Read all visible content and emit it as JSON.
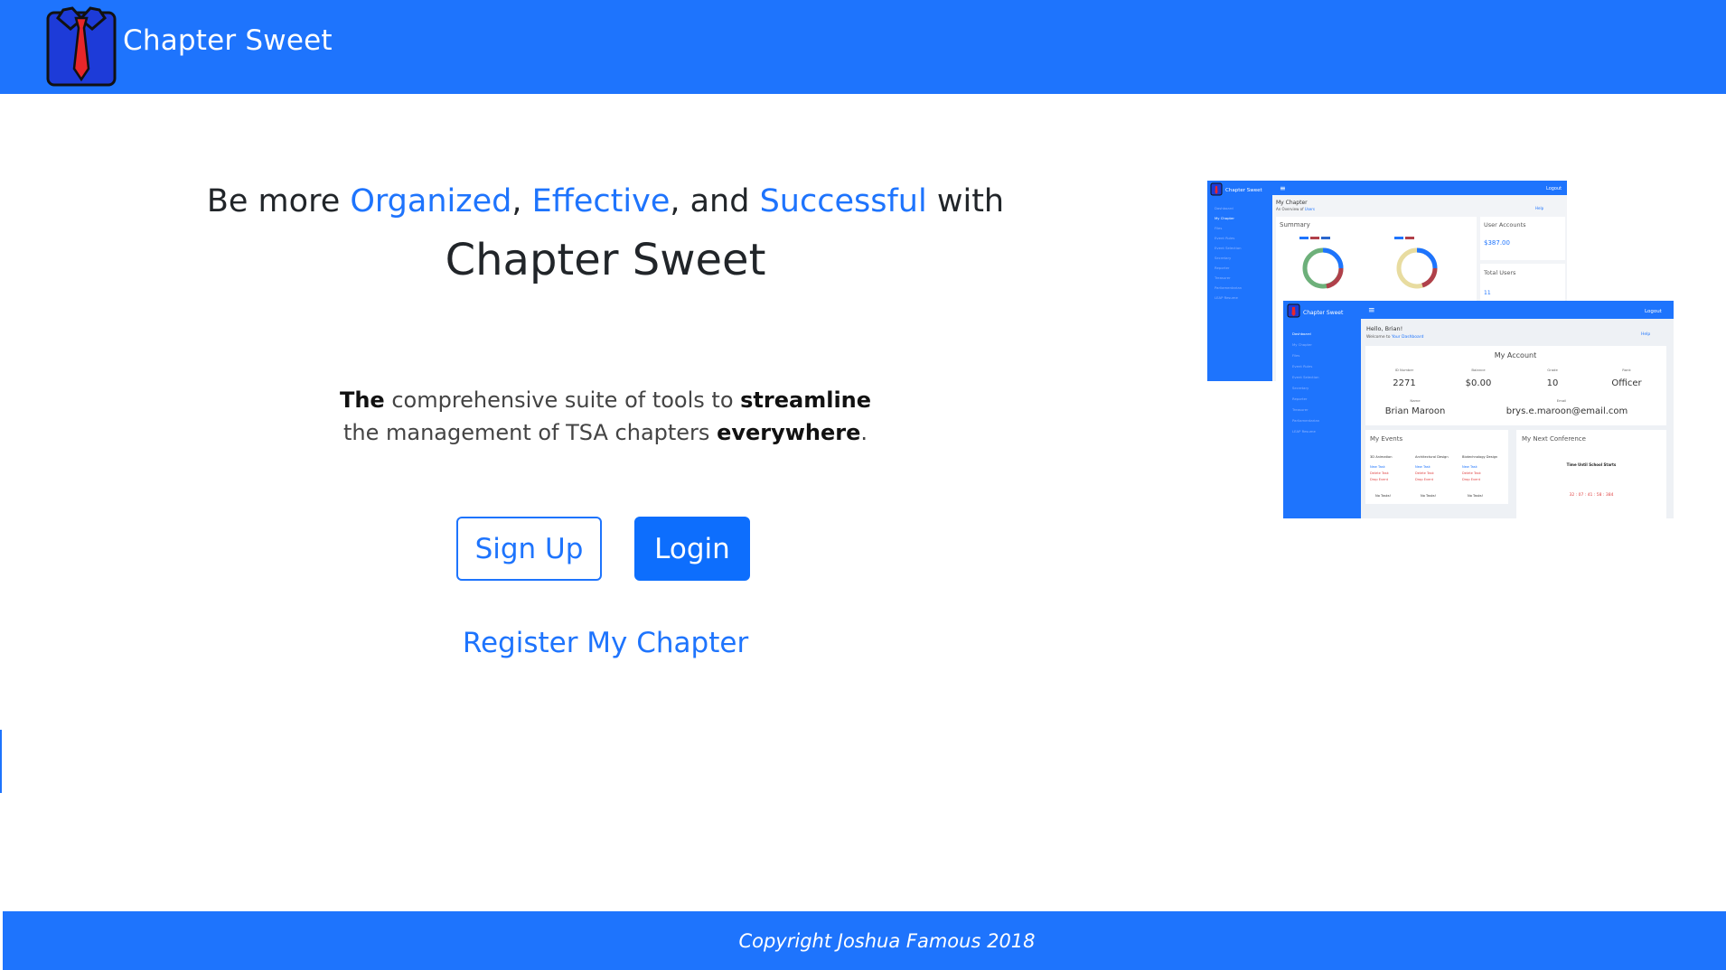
{
  "navbar": {
    "brand": "Chapter Sweet",
    "logo_icon": "tie-shirt-icon"
  },
  "hero": {
    "prefix": "Be more ",
    "word1": "Organized",
    "sep1": ", ",
    "word2": "Effective",
    "sep2": ", and ",
    "word3": "Successful",
    "suffix": " with",
    "title": "Chapter Sweet"
  },
  "tagline": {
    "p1": "The",
    "p2": " comprehensive suite of tools to ",
    "p3": "streamline",
    "p4": " the management of TSA chapters ",
    "p5": "everywhere",
    "p6": "."
  },
  "buttons": {
    "signup": "Sign Up",
    "login": "Login"
  },
  "register_link": "Register My Chapter",
  "footer": {
    "copyright": "Copyright Joshua Famous 2018"
  },
  "preview": {
    "back": {
      "brand": "Chapter Sweet",
      "logout": "Logout",
      "title": "My Chapter",
      "subtitle_prefix": "An Overview of ",
      "subtitle_link": "Users",
      "help": "Help",
      "summary": "Summary",
      "user_accounts": "User Accounts",
      "user_accounts_value": "$387.00",
      "total_users": "Total Users",
      "total_users_value": "11"
    },
    "front": {
      "brand": "Chapter Sweet",
      "logout": "Logout",
      "greeting": "Hello, Brian!",
      "welcome_prefix": "Welcome to ",
      "welcome_link": "Your Dashboard",
      "help": "Help",
      "my_account": "My Account",
      "id_label": "ID Number",
      "id_value": "2271",
      "balance_label": "Balance",
      "balance_value": "$0.00",
      "grade_label": "Grade",
      "grade_value": "10",
      "rank_label": "Rank",
      "rank_value": "Officer",
      "name_label": "Name",
      "name_value": "Brian Maroon",
      "email_label": "Email",
      "email_value": "brys.e.maroon@email.com",
      "my_events": "My Events",
      "my_next_conference": "My Next Conference",
      "event1": "3D Animation",
      "event2": "Architectural Design",
      "event3": "Biotechnology Design",
      "new_task": "New Task",
      "delete_task": "Delete Task",
      "drop_event": "Drop Event",
      "no_tasks": "No Tasks!",
      "timer_title": "Time Until School Starts",
      "timer_values": "32 : 07 : 41 : 58 : 384"
    },
    "menu": [
      "Dashboard",
      "My Chapter",
      "Files",
      "Event Rules",
      "Event Selection",
      "Secretary",
      "Reporter",
      "Treasurer",
      "Parliamentarian",
      "LEAP Resume"
    ]
  }
}
